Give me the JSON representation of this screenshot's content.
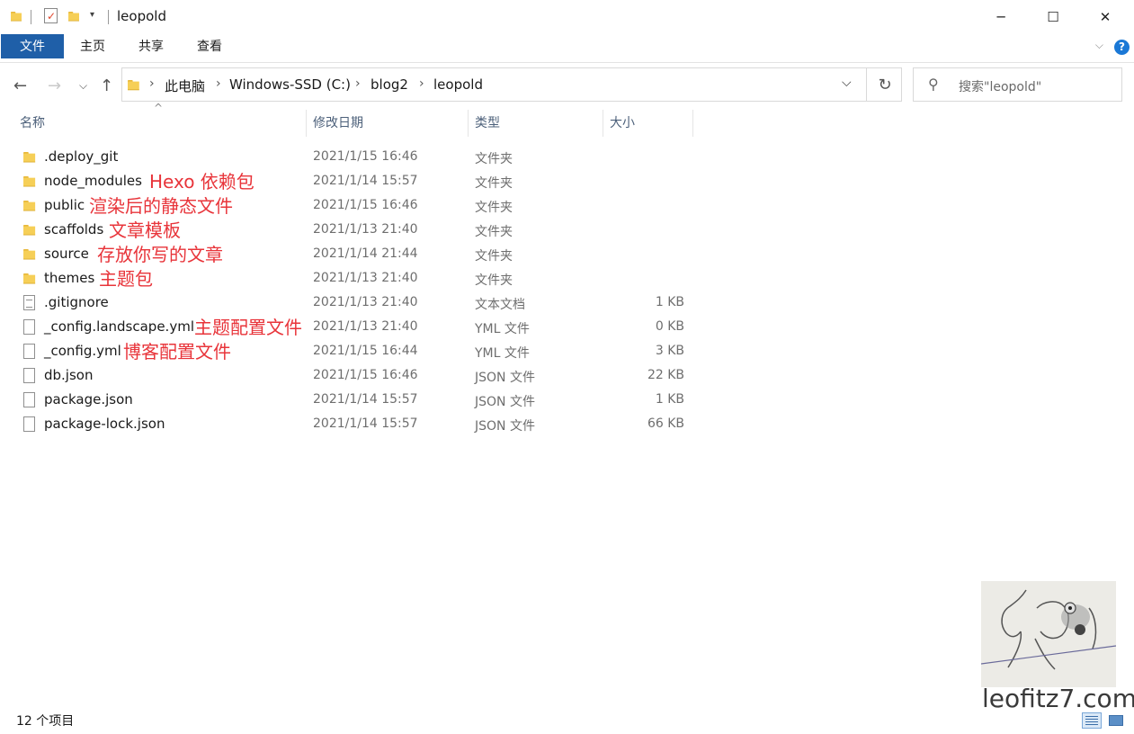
{
  "window": {
    "title": "leopold",
    "minimize": "─",
    "maximize": "☐",
    "close": "✕"
  },
  "ribbon": {
    "tabs": [
      "文件",
      "主页",
      "共享",
      "查看"
    ],
    "help": "?"
  },
  "address": {
    "crumbs": [
      "此电脑",
      "Windows-SSD (C:)",
      "blog2",
      "leopold"
    ],
    "search_placeholder": "搜索\"leopold\""
  },
  "columns": {
    "name": "名称",
    "modified": "修改日期",
    "type": "类型",
    "size": "大小"
  },
  "files": [
    {
      "name": ".deploy_git",
      "date": "2021/1/15 16:46",
      "type": "文件夹",
      "size": "",
      "kind": "folder",
      "note": ""
    },
    {
      "name": "node_modules",
      "date": "2021/1/14 15:57",
      "type": "文件夹",
      "size": "",
      "kind": "folder",
      "note": "Hexo 依赖包"
    },
    {
      "name": "public",
      "date": "2021/1/15 16:46",
      "type": "文件夹",
      "size": "",
      "kind": "folder",
      "note": "渲染后的静态文件"
    },
    {
      "name": "scaffolds",
      "date": "2021/1/13 21:40",
      "type": "文件夹",
      "size": "",
      "kind": "folder",
      "note": "文章模板"
    },
    {
      "name": "source",
      "date": "2021/1/14 21:44",
      "type": "文件夹",
      "size": "",
      "kind": "folder",
      "note": "存放你写的文章"
    },
    {
      "name": "themes",
      "date": "2021/1/13 21:40",
      "type": "文件夹",
      "size": "",
      "kind": "folder",
      "note": "主题包"
    },
    {
      "name": ".gitignore",
      "date": "2021/1/13 21:40",
      "type": "文本文档",
      "size": "1 KB",
      "kind": "text",
      "note": ""
    },
    {
      "name": "_config.landscape.yml",
      "date": "2021/1/13 21:40",
      "type": "YML 文件",
      "size": "0 KB",
      "kind": "file",
      "note": "主题配置文件"
    },
    {
      "name": "_config.yml",
      "date": "2021/1/15 16:44",
      "type": "YML 文件",
      "size": "3 KB",
      "kind": "file",
      "note": "博客配置文件"
    },
    {
      "name": "db.json",
      "date": "2021/1/15 16:46",
      "type": "JSON 文件",
      "size": "22 KB",
      "kind": "file",
      "note": ""
    },
    {
      "name": "package.json",
      "date": "2021/1/14 15:57",
      "type": "JSON 文件",
      "size": "1 KB",
      "kind": "file",
      "note": ""
    },
    {
      "name": "package-lock.json",
      "date": "2021/1/14 15:57",
      "type": "JSON 文件",
      "size": "66 KB",
      "kind": "file",
      "note": ""
    }
  ],
  "status": {
    "count": "12 个项目"
  },
  "watermark": {
    "text": "leofitz7.com"
  },
  "colors": {
    "accent": "#1f5fa8",
    "annotation": "#e8343a",
    "folder": "#f6cf57"
  }
}
